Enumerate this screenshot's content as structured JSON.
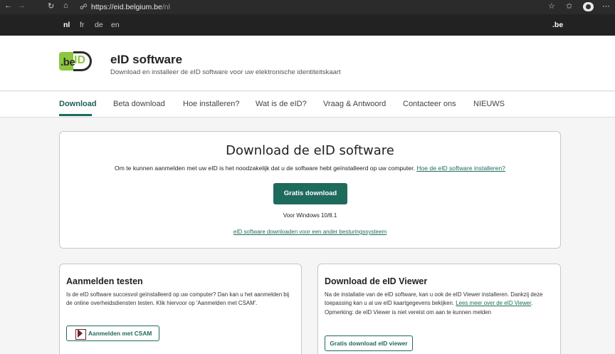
{
  "browser": {
    "url_host": "https://eid.belgium.be",
    "url_path": "/nl",
    "icons": [
      "back-icon",
      "forward-icon",
      "refresh-icon",
      "home-icon",
      "lock-icon",
      "star-icon",
      "favorites-icon",
      "collections-icon",
      "profile-icon",
      "more-icon"
    ],
    "glyphs": {
      "back": "←",
      "forward": "→",
      "refresh": "↻",
      "home": "⌂",
      "lock": "🔒",
      "star": "☆",
      "favorites": "✩",
      "collections": "⧉",
      "more": "⋯"
    }
  },
  "languages": [
    {
      "code": "nl",
      "active": true
    },
    {
      "code": "fr",
      "active": false
    },
    {
      "code": "de",
      "active": false
    },
    {
      "code": "en",
      "active": false
    }
  ],
  "be_mark": ".be",
  "header": {
    "logo_be": ".be",
    "logo_id": "ID",
    "title": "eID software",
    "subtitle": "Download en installeer de eID software voor uw elektronische identiteitskaart",
    "logo_color": "#8dc63f"
  },
  "nav": {
    "items": [
      "Download",
      "Beta download",
      "Hoe installeren?",
      "Wat is de eID?",
      "Vraag & Antwoord",
      "Contacteer ons",
      "NIEUWS"
    ],
    "active_index": 0,
    "accent": "#1e6b5c"
  },
  "download": {
    "title": "Download de eID software",
    "intro": "Om te kunnen aanmelden met uw eID is het noodzakelijk dat u de software hebt geïnstalleerd op uw computer.",
    "intro_link": "Hoe de eID software installeren?",
    "button": "Gratis download",
    "os": "Voor Windows 10/8.1",
    "other_link": "eID software downloaden voor een ander besturingssysteem"
  },
  "test": {
    "title": "Aanmelden testen",
    "body": "Is de eID software succesvol geïnstalleerd op uw computer? Dan kan u het aanmelden bij de online overheidsdiensten testen. Klik hiervoor op 'Aanmelden met CSAM'.",
    "button": "Aanmelden met CSAM"
  },
  "viewer": {
    "title": "Download de eID Viewer",
    "body": "Na de installatie van de eID software, kan u ook de eID Viewer installeren. Dankzij deze toepassing kan u al uw eID kaartgegevens bekijken.",
    "link": "Lees meer over de eID Viewer",
    "note": "Opmerking: de eID Viewer is niet vereist om aan te kunnen melden",
    "button": "Gratis download eID viewer"
  }
}
